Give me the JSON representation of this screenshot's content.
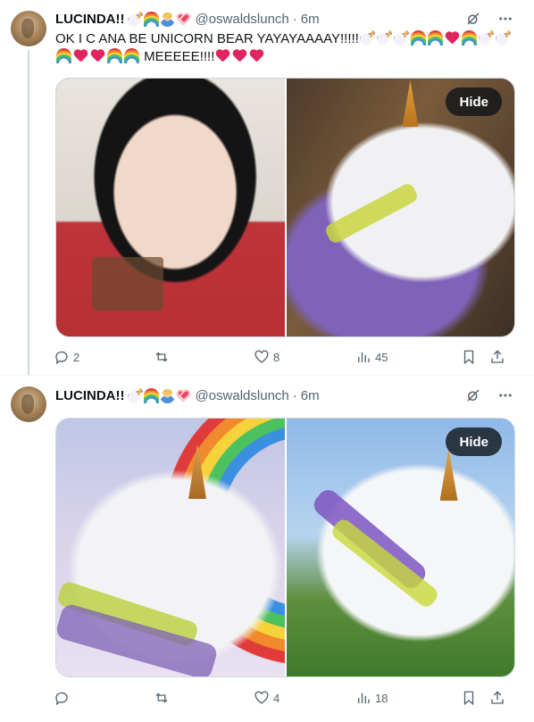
{
  "posts": [
    {
      "author": {
        "name": "LUCINDA!!",
        "name_emojis": [
          "unicorn-emoji",
          "rainbow-emoji",
          "person-emoji",
          "sparkling-heart-emoji"
        ],
        "handle": "@oswaldslunch",
        "separator": "·",
        "time": "6m"
      },
      "text_start": "OK I C ANA BE UNICORN BEAR YAYAYAAAAY!!!!!",
      "text_end": "MEEEEE!!!!",
      "media": [
        {
          "alt": "girl-photo"
        },
        {
          "alt": "unicorn-bear-render",
          "hide_label": "Hide"
        }
      ],
      "metrics": {
        "replies": "2",
        "reposts": "",
        "likes": "8",
        "views": "45"
      }
    },
    {
      "author": {
        "name": "LUCINDA!!",
        "name_emojis": [
          "unicorn-emoji",
          "rainbow-emoji",
          "person-emoji",
          "sparkling-heart-emoji"
        ],
        "handle": "@oswaldslunch",
        "separator": "·",
        "time": "6m"
      },
      "media": [
        {
          "alt": "rainbow-unicorn-bear"
        },
        {
          "alt": "unicorn-bear-grass",
          "hide_label": "Hide"
        }
      ],
      "metrics": {
        "replies": "",
        "reposts": "",
        "likes": "4",
        "views": "18"
      }
    }
  ],
  "colors": {
    "text": "#0f1419",
    "muted": "#536471",
    "border": "#cfd9de",
    "thread_line": "#cfd9de",
    "hide_bg": "#0f1419"
  }
}
